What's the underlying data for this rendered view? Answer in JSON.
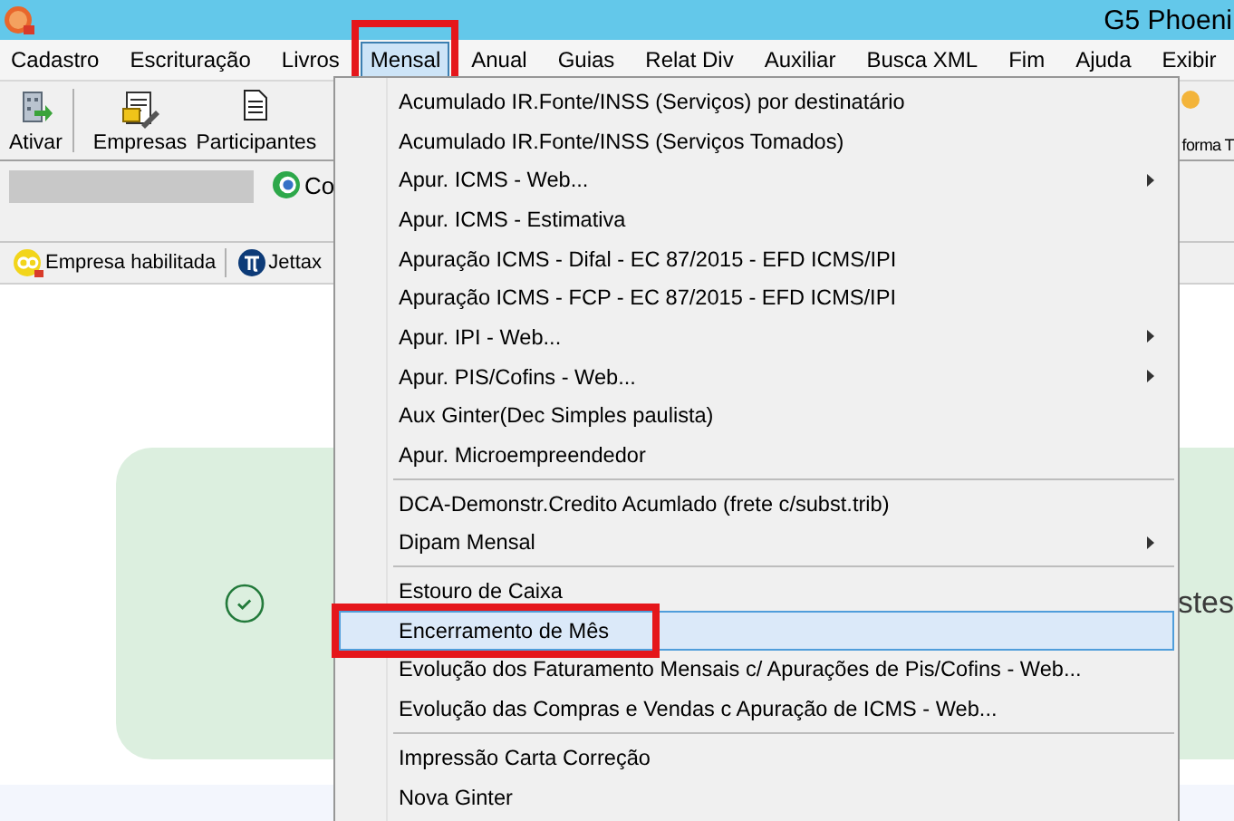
{
  "window": {
    "title": "G5 Phoeni"
  },
  "menu_bar": [
    {
      "label": "Cadastro",
      "selected": false,
      "highlighted": false
    },
    {
      "label": "Escrituração",
      "selected": false,
      "highlighted": false
    },
    {
      "label": "Livros",
      "selected": false,
      "highlighted": false
    },
    {
      "label": "Mensal",
      "selected": true,
      "highlighted": true
    },
    {
      "label": "Anual",
      "selected": false,
      "highlighted": false
    },
    {
      "label": "Guias",
      "selected": false,
      "highlighted": false
    },
    {
      "label": "Relat Div",
      "selected": false,
      "highlighted": false
    },
    {
      "label": "Auxiliar",
      "selected": false,
      "highlighted": false
    },
    {
      "label": "Busca XML",
      "selected": false,
      "highlighted": false
    },
    {
      "label": "Fim",
      "selected": false,
      "highlighted": false
    },
    {
      "label": "Ajuda",
      "selected": false,
      "highlighted": false
    },
    {
      "label": "Exibir",
      "selected": false,
      "highlighted": false
    }
  ],
  "toolbar": [
    {
      "kind": "activate",
      "label": "Ativar"
    },
    {
      "kind": "companies",
      "label": "Empresas"
    },
    {
      "kind": "participants",
      "label": "Participantes"
    },
    {
      "kind": "platform",
      "label": "forma T"
    }
  ],
  "company_row": {
    "action_label": "Co"
  },
  "status_row": [
    {
      "kind": "company",
      "label": "Empresa habilitada"
    },
    {
      "kind": "jettax",
      "label": "Jettax"
    }
  ],
  "notice": {
    "text": "stes"
  },
  "dropdown": [
    {
      "kind": "item",
      "label": "Acumulado IR.Fonte/INSS (Serviços) por destinatário",
      "submenu": false,
      "selected": false,
      "highlighted": false
    },
    {
      "kind": "item",
      "label": "Acumulado IR.Fonte/INSS (Serviços Tomados)",
      "submenu": false,
      "selected": false,
      "highlighted": false
    },
    {
      "kind": "item",
      "label": "Apur. ICMS - Web...",
      "submenu": true,
      "selected": false,
      "highlighted": false
    },
    {
      "kind": "item",
      "label": "Apur. ICMS - Estimativa",
      "submenu": false,
      "selected": false,
      "highlighted": false
    },
    {
      "kind": "item",
      "label": "Apuração ICMS - Difal - EC 87/2015 - EFD ICMS/IPI",
      "submenu": false,
      "selected": false,
      "highlighted": false
    },
    {
      "kind": "item",
      "label": "Apuração ICMS - FCP - EC 87/2015 - EFD ICMS/IPI",
      "submenu": false,
      "selected": false,
      "highlighted": false
    },
    {
      "kind": "item",
      "label": "Apur. IPI - Web...",
      "submenu": true,
      "selected": false,
      "highlighted": false
    },
    {
      "kind": "item",
      "label": "Apur. PIS/Cofins - Web...",
      "submenu": true,
      "selected": false,
      "highlighted": false
    },
    {
      "kind": "item",
      "label": "Aux Ginter(Dec Simples paulista)",
      "submenu": false,
      "selected": false,
      "highlighted": false
    },
    {
      "kind": "item",
      "label": "Apur. Microempreendedor",
      "submenu": false,
      "selected": false,
      "highlighted": false
    },
    {
      "kind": "separator"
    },
    {
      "kind": "item",
      "label": "DCA-Demonstr.Credito Acumlado (frete c/subst.trib)",
      "submenu": false,
      "selected": false,
      "highlighted": false
    },
    {
      "kind": "item",
      "label": "Dipam Mensal",
      "submenu": true,
      "selected": false,
      "highlighted": false
    },
    {
      "kind": "separator"
    },
    {
      "kind": "item",
      "label": "Estouro de Caixa",
      "submenu": false,
      "selected": false,
      "highlighted": false
    },
    {
      "kind": "item",
      "label": "Encerramento de Mês",
      "submenu": false,
      "selected": true,
      "highlighted": true
    },
    {
      "kind": "item",
      "label": "Evolução dos Faturamento Mensais c/ Apurações de Pis/Cofins - Web...",
      "submenu": false,
      "selected": false,
      "highlighted": false
    },
    {
      "kind": "item",
      "label": "Evolução das Compras e Vendas c Apuração de ICMS - Web...",
      "submenu": false,
      "selected": false,
      "highlighted": false
    },
    {
      "kind": "separator"
    },
    {
      "kind": "item",
      "label": "Impressão Carta Correção",
      "submenu": false,
      "selected": false,
      "highlighted": false
    },
    {
      "kind": "item",
      "label": "Nova Ginter",
      "submenu": false,
      "selected": false,
      "highlighted": false
    }
  ]
}
